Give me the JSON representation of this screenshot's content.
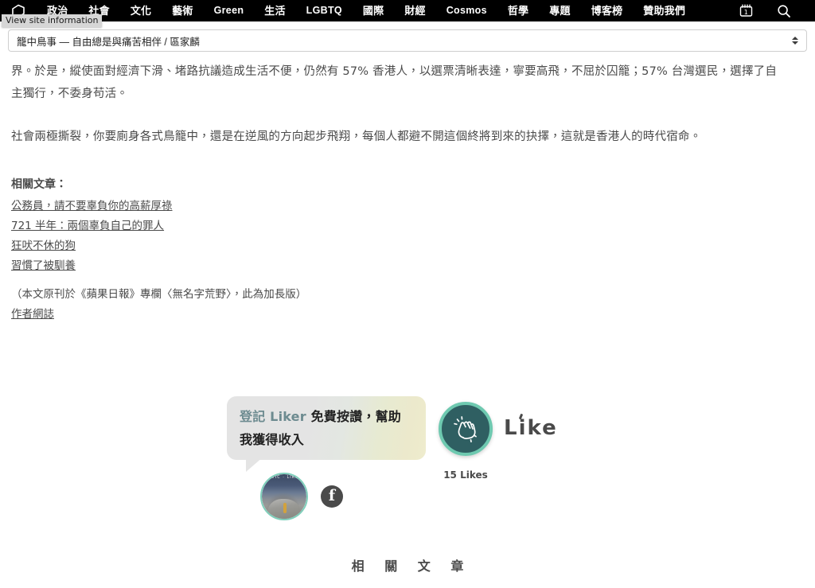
{
  "navbar": {
    "logo_icon": "cube-logo-icon",
    "items": [
      {
        "label": "政治",
        "latin": false
      },
      {
        "label": "社會",
        "latin": false
      },
      {
        "label": "文化",
        "latin": false
      },
      {
        "label": "藝術",
        "latin": false
      },
      {
        "label": "Green",
        "latin": true
      },
      {
        "label": "生活",
        "latin": false
      },
      {
        "label": "LGBTQ",
        "latin": true
      },
      {
        "label": "國際",
        "latin": false
      },
      {
        "label": "財經",
        "latin": false
      },
      {
        "label": "Cosmos",
        "latin": true
      },
      {
        "label": "哲學",
        "latin": false
      },
      {
        "label": "專題",
        "latin": false
      },
      {
        "label": "博客榜",
        "latin": false
      },
      {
        "label": "贊助我們",
        "latin": false
      }
    ],
    "calendar_icon": "calendar-icon",
    "calendar_day": "1",
    "search_icon": "search-icon"
  },
  "tooltip": {
    "text": "View site information"
  },
  "article_select": {
    "value": "籠中鳥事 — 自由總是與痛苦相伴 / 區家麟",
    "up_arrow": "chevron-up-icon",
    "down_arrow": "chevron-down-icon"
  },
  "article": {
    "paragraph_1": "界。於是，縱使面對經濟下滑、堵路抗議造成生活不便，仍然有 57% 香港人，以選票清晰表達，寧要高飛，不屈於囚籠；57% 台灣選民，選擇了自主獨行，不委身苟活。",
    "paragraph_2": "社會兩極撕裂，你要廁身各式鳥籠中，還是在逆風的方向起步飛翔，每個人都避不開這個終將到來的抉擇，這就是香港人的時代宿命。",
    "related_heading": "相關文章：",
    "related_links": [
      "公務員，請不要辜負你的高薪厚祿",
      "721 半年：兩個辜負自己的罪人",
      "狂吠不休的狗",
      "習慣了被馴養"
    ],
    "source_note": "（本文原刊於《蘋果日報》專欄〈無名字荒野〉，此為加長版）",
    "author_link": "作者網誌"
  },
  "liker": {
    "bubble_highlight": "登記 Liker",
    "bubble_rest": " 免費按讚，幫助我獲得收入",
    "avatar_ring_text": "civic · liker",
    "avatar_name": "avatar",
    "facebook_glyph": "f",
    "like_icon": "clapping-hands-icon",
    "like_count": "15 Likes",
    "wordmark_pre": "L",
    "wordmark_i": "i",
    "wordmark_post": "ke",
    "colors": {
      "like_circle": "#2f5f62",
      "like_ring": "#6ec9b0",
      "highlight_text": "#6d8b90",
      "facebook_button": "#4a4a4a"
    }
  },
  "footer": {
    "section_heading": "相 關 文 章"
  }
}
